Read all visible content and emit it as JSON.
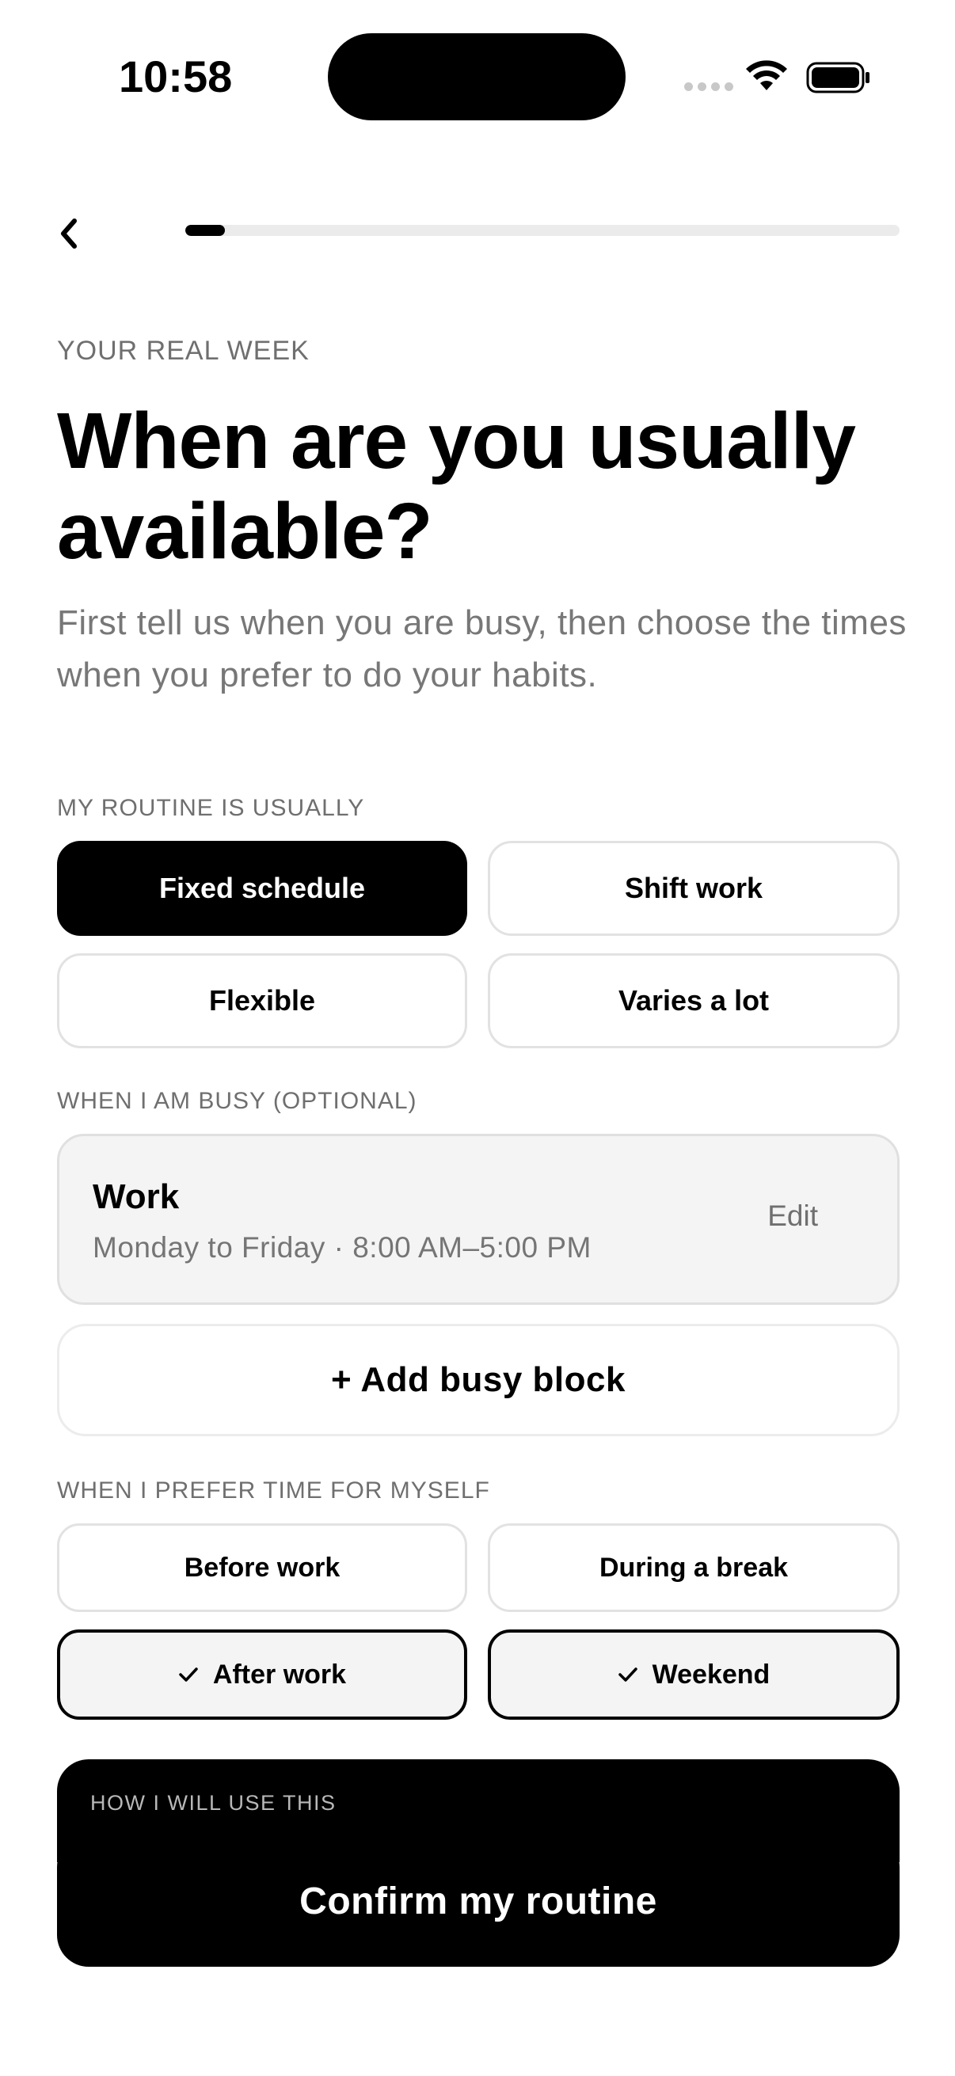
{
  "status_bar": {
    "time": "10:58",
    "icons": [
      "cellular-signal-icon",
      "wifi-icon",
      "battery-icon"
    ]
  },
  "nav": {
    "back_icon": "chevron-left-icon",
    "progress": 0.055
  },
  "header": {
    "eyebrow": "YOUR REAL WEEK",
    "title": "When are you usually available?",
    "subtitle": "First tell us when you are busy, then choose the times when you prefer to do your habits."
  },
  "routine": {
    "label": "MY ROUTINE IS USUALLY",
    "options": [
      {
        "label": "Fixed schedule",
        "selected": true
      },
      {
        "label": "Shift work",
        "selected": false
      },
      {
        "label": "Flexible",
        "selected": false
      },
      {
        "label": "Varies a lot",
        "selected": false
      }
    ]
  },
  "busy": {
    "label": "WHEN I AM BUSY (OPTIONAL)",
    "block": {
      "title": "Work",
      "detail": "Monday to Friday · 8:00 AM–5:00 PM",
      "edit_label": "Edit"
    },
    "add_label": "+ Add busy block"
  },
  "preferred": {
    "label": "WHEN I PREFER TIME FOR MYSELF",
    "options": [
      {
        "label": "Before work",
        "checked": false
      },
      {
        "label": "During a break",
        "checked": false
      },
      {
        "label": "After work",
        "checked": true
      },
      {
        "label": "Weekend",
        "checked": true
      }
    ]
  },
  "info": {
    "label": "HOW I WILL USE THIS"
  },
  "cta": {
    "label": "Confirm my routine"
  },
  "colors": {
    "primary": "#000000",
    "border": "#e2e2e2",
    "muted_text": "#777777",
    "card_bg": "#f4f4f4",
    "progress_track": "#ebebeb"
  }
}
